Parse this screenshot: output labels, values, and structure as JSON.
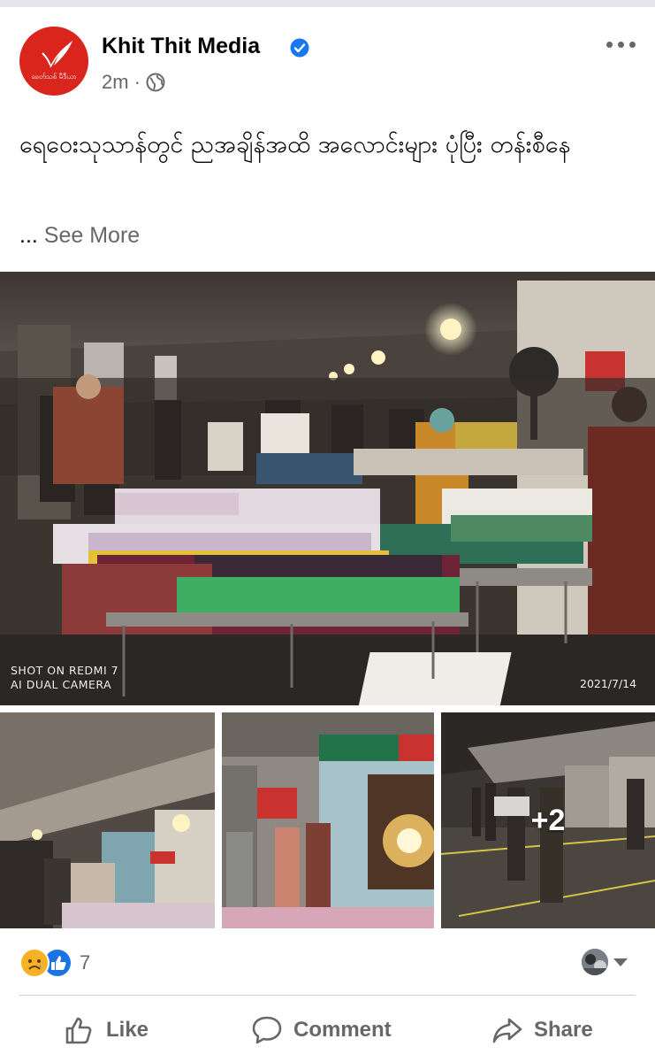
{
  "post": {
    "page_name": "Khit Thit Media",
    "time": "2m",
    "separator": "·",
    "avatar_text": "ခေတ်သစ် မီဒီယာ",
    "text": "ရေဝေးသုသာန်တွင် ညအချိန်အထိ အလောင်းများ ပုံပြီး တန်းစီနေ",
    "see_more_prefix": "...",
    "see_more": "See More"
  },
  "photos": {
    "main_stamp_left_1": "SHOT ON REDMI 7",
    "main_stamp_left_2": "AI DUAL CAMERA",
    "main_stamp_right": "2021/7/14",
    "more_count": "+2"
  },
  "reactions": {
    "count": "7",
    "types": [
      "sad",
      "like"
    ]
  },
  "actions": {
    "like": "Like",
    "comment": "Comment",
    "share": "Share"
  },
  "colors": {
    "brand_red": "#d9251c",
    "verified_blue": "#1877f2",
    "secondary_text": "#65676b"
  },
  "icons": [
    "more-options-icon",
    "verified-badge-icon",
    "globe-icon",
    "like-icon",
    "comment-icon",
    "share-icon",
    "sad-reaction-icon",
    "like-reaction-icon"
  ]
}
